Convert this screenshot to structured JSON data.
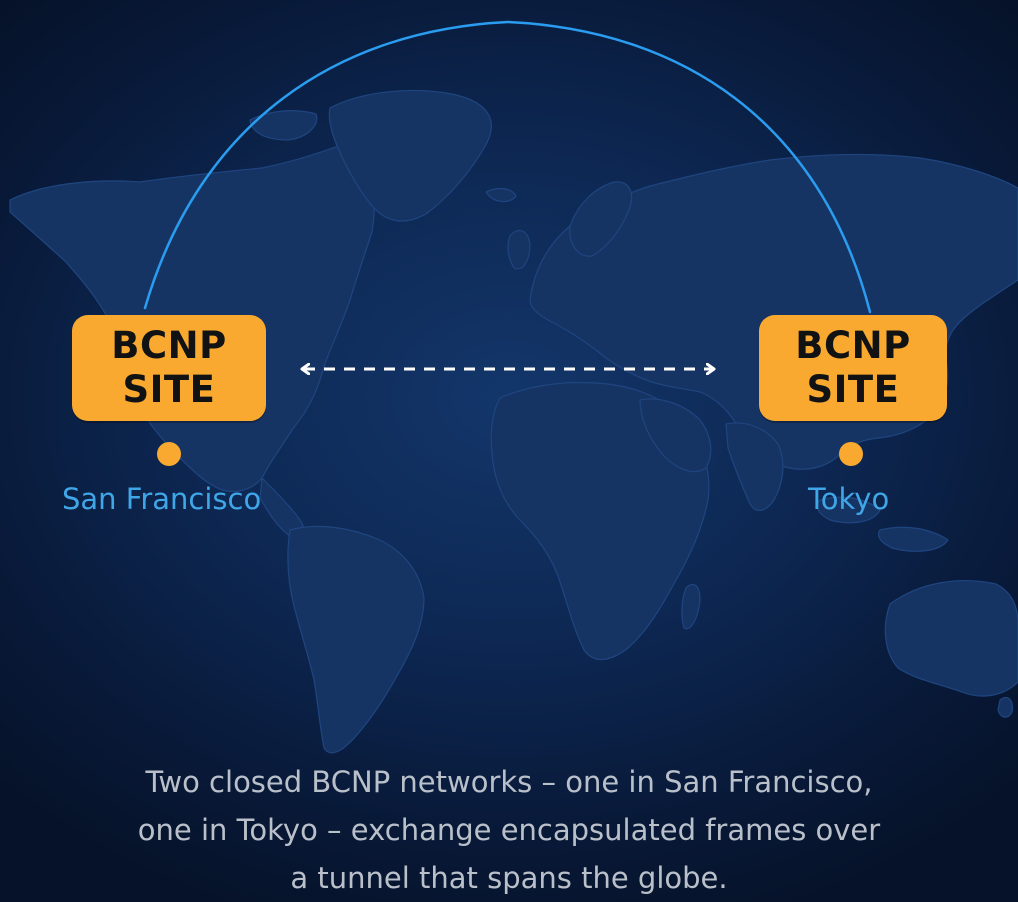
{
  "sites": [
    {
      "box_line1": "BCNP",
      "box_line2": "SITE",
      "city": "San Francisco"
    },
    {
      "box_line1": "BCNP",
      "box_line2": "SITE",
      "city": "Tokyo"
    }
  ],
  "caption_lines": [
    "Two closed BCNP networks – one in San Francisco,",
    "one in Tokyo – exchange encapsulated frames over",
    "a tunnel that spans the globe."
  ],
  "colors": {
    "background": "#0a1a3a",
    "land": "#163463",
    "site_box": "#f9a92f",
    "arc": "#2a9df0",
    "city_label": "#3fa6e8",
    "tunnel_arrow": "#ffffff",
    "caption": "#b9c0c9"
  },
  "icons": {
    "tunnel": "double-headed-dashed-arrow",
    "arc": "great-circle-arc"
  }
}
